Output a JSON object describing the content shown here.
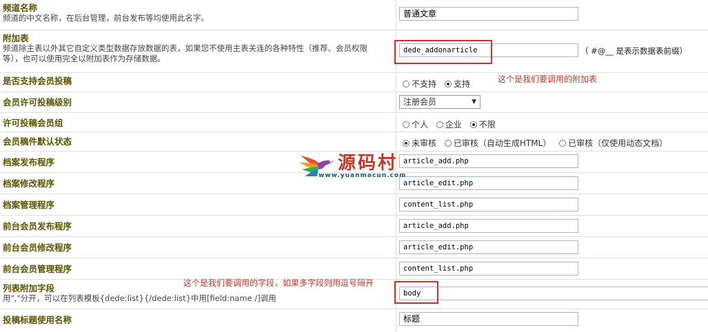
{
  "rows": [
    {
      "label": "频道名称",
      "desc": "频道的中文名称，在后台管理，前台发布等均使用此名字。",
      "value": "普通文章"
    },
    {
      "label": "附加表",
      "desc1": "频道除主表以外其它自定义类型数据存放数据的表，如果您不使用主表关连的各种特性（推荐、会员权限",
      "desc2": "等），也可以使用完全以附加表作为存储数据。",
      "value": "dede_addonarticle",
      "suffix": "（ #@__ 是表示数据表前缀）"
    },
    {
      "label": "是否支持会员投稿",
      "options": [
        "不支持",
        "支持"
      ]
    },
    {
      "label": "会员许可投稿级别",
      "selected": "注册会员"
    },
    {
      "label": "许可投稿会员组",
      "options": [
        "个人",
        "企业",
        "不限"
      ]
    },
    {
      "label": "会员稿件默认状态",
      "options": [
        "未审核",
        "已审核（自动生成HTML）",
        "已审核（仅使用动态文档）"
      ]
    },
    {
      "label": "档案发布程序",
      "value": "article_add.php"
    },
    {
      "label": "档案修改程序",
      "value": "article_edit.php"
    },
    {
      "label": "档案管理程序",
      "value": "content_list.php"
    },
    {
      "label": "前台会员发布程序",
      "value": "article_add.php"
    },
    {
      "label": "前台会员修改程序",
      "value": "article_edit.php"
    },
    {
      "label": "前台会员管理程序",
      "value": "content_list.php"
    },
    {
      "label": "列表附加字段",
      "desc": "用\",\"分开，可以在列表模板{dede:list}{/dede:list}中用[field:name /]调用",
      "value": "body"
    },
    {
      "label": "投稿标题使用名称",
      "value": "标题"
    }
  ],
  "annotations": {
    "addon_table_note": "这个是我们要调用的附加表",
    "fields_note": "这个是我们要调用的字段，如果多字段则用逗号隔开"
  },
  "watermark": {
    "name": "源码村",
    "url": "www.yuanmacun.com"
  },
  "colors": {
    "label": "#5a5500",
    "annotation": "#c0392b",
    "highlight_box": "#d92b2b",
    "grid": "#dbe3d4"
  }
}
